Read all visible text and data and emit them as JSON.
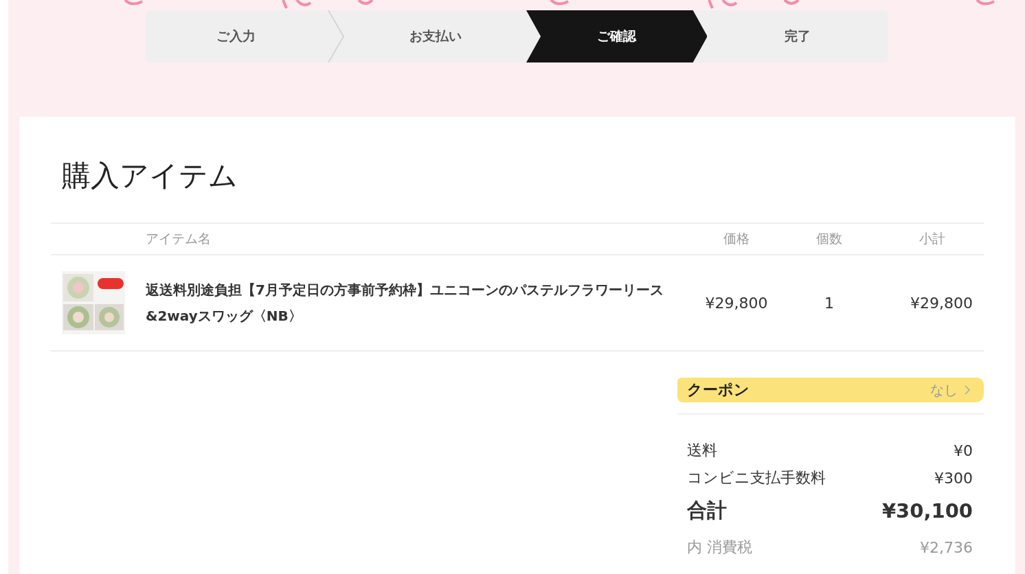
{
  "steps": [
    {
      "label": "ご入力",
      "selected": false
    },
    {
      "label": "お支払い",
      "selected": false
    },
    {
      "label": "ご確認",
      "selected": true
    },
    {
      "label": "完了",
      "selected": false
    }
  ],
  "section_title": "購入アイテム",
  "table": {
    "columns": [
      "アイテム名",
      "価格",
      "個数",
      "小計"
    ],
    "rows": [
      {
        "name": "返送料別途負担【7月予定日の方事前予約枠】ユニコーンのパステルフラワーリース &2wayスワッグ〈NB〉",
        "price": "¥29,800",
        "quantity": "1",
        "subtotal": "¥29,800"
      }
    ]
  },
  "coupon": {
    "label": "クーポン",
    "value": "なし",
    "highlighted": true
  },
  "summary": [
    {
      "label": "送料",
      "value": "¥0",
      "kind": "normal"
    },
    {
      "label": "コンビニ支払手数料",
      "value": "¥300",
      "kind": "normal"
    },
    {
      "label": "合計",
      "value": "¥30,100",
      "kind": "total"
    },
    {
      "label": "内 消費税",
      "value": "¥2,736",
      "kind": "note"
    }
  ]
}
